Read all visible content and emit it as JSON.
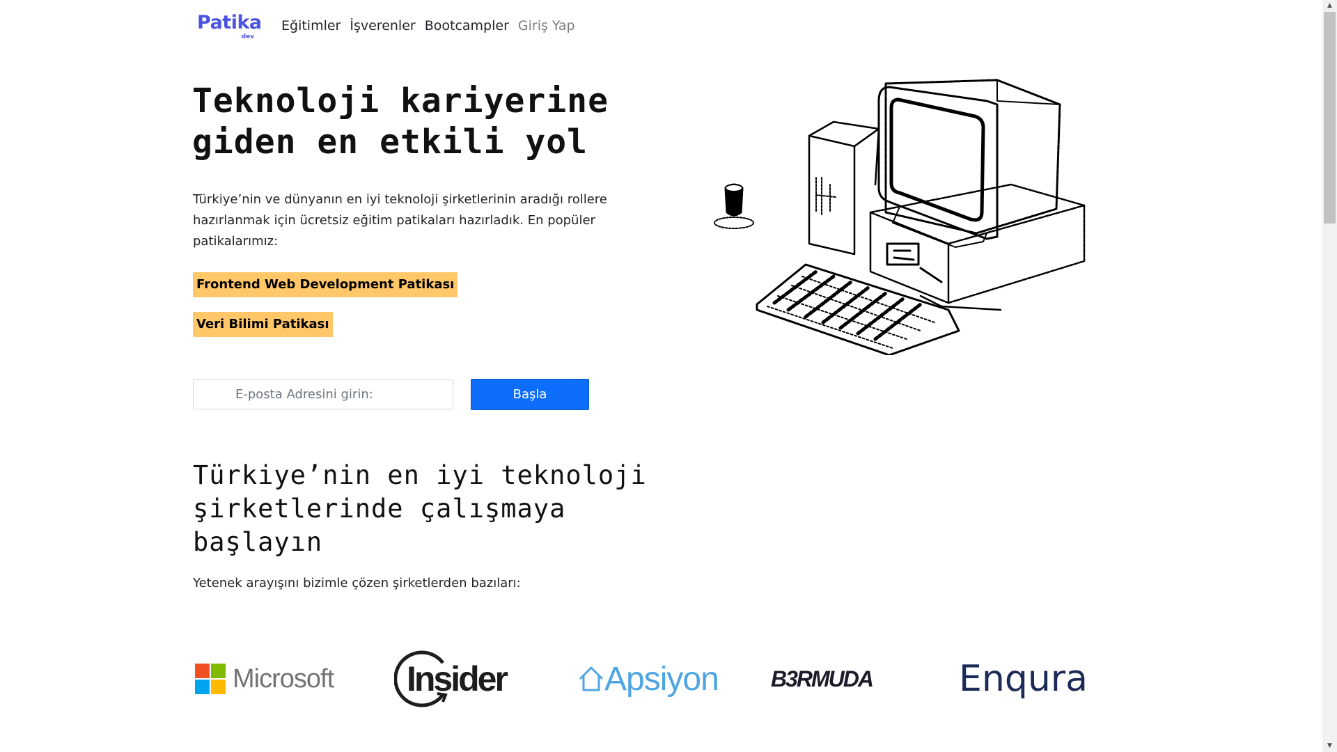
{
  "logo": {
    "name": "Patika",
    "sub": "dev"
  },
  "nav": [
    {
      "label": "Eğitimler"
    },
    {
      "label": "İşverenler"
    },
    {
      "label": "Bootcampler"
    },
    {
      "label": "Giriş Yap"
    }
  ],
  "hero": {
    "title_line1": "Teknoloji kariyerine",
    "title_line2": "giden en etkili yol",
    "description": "Türkiye’nin ve dünyanın en iyi teknoloji şirketlerinin aradığı rollere hazırlanmak için ücretsiz eğitim patikaları hazırladık. En popüler patikalarımız:",
    "paths": [
      {
        "label": "Frontend Web Development Patikası"
      },
      {
        "label": "Veri Bilimi Patikası"
      }
    ],
    "email_placeholder": "E-posta Adresini girin:",
    "start_label": "Başla",
    "illustration_icon": "retro-computer-illustration"
  },
  "companies": {
    "title": "Türkiye’nin en iyi teknoloji şirketlerinde çalışmaya başlayın",
    "subtitle": "Yetenek arayışını bizimle çözen şirketlerden bazıları:",
    "logos": [
      {
        "name": "Microsoft"
      },
      {
        "name": "Insider"
      },
      {
        "name": "Apsiyon"
      },
      {
        "name": "B3RMUDA"
      },
      {
        "name": "Enqura"
      }
    ]
  },
  "colors": {
    "path_bg": "#ffc768",
    "primary": "#0d6efd",
    "brand": "#4b53e1"
  }
}
